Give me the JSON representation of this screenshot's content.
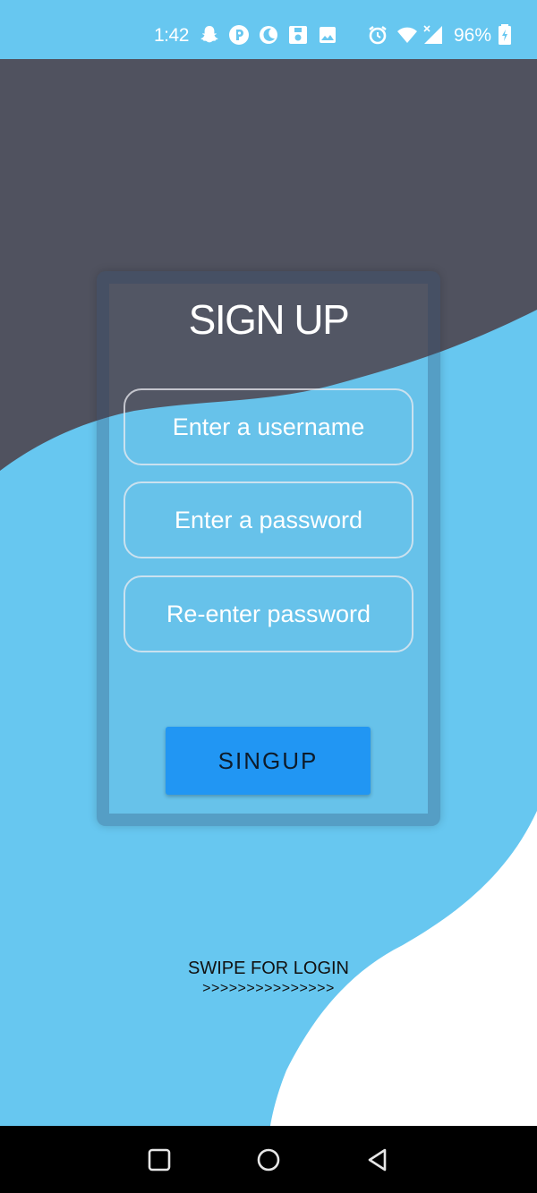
{
  "status_bar": {
    "time": "1:42",
    "battery_text": "96%",
    "icons": [
      "snapchat-icon",
      "app-icon",
      "moon-icon",
      "calendar-icon",
      "image-icon",
      "alarm-icon",
      "wifi-icon",
      "signal-icon",
      "battery-icon"
    ]
  },
  "colors": {
    "sky_blue": "#67c7f0",
    "dark_wave": "#50525f",
    "button_blue": "#2196f3"
  },
  "signup": {
    "title": "SIGN UP",
    "username_placeholder": "Enter a username",
    "password_placeholder": "Enter a password",
    "reenter_placeholder": "Re-enter password",
    "button_label": "SINGUP"
  },
  "swipe": {
    "label": "SWIPE FOR LOGIN",
    "arrows": ">>>>>>>>>>>>>>>"
  },
  "nav_bar": {
    "buttons": [
      "recents-icon",
      "home-icon",
      "back-icon"
    ]
  }
}
